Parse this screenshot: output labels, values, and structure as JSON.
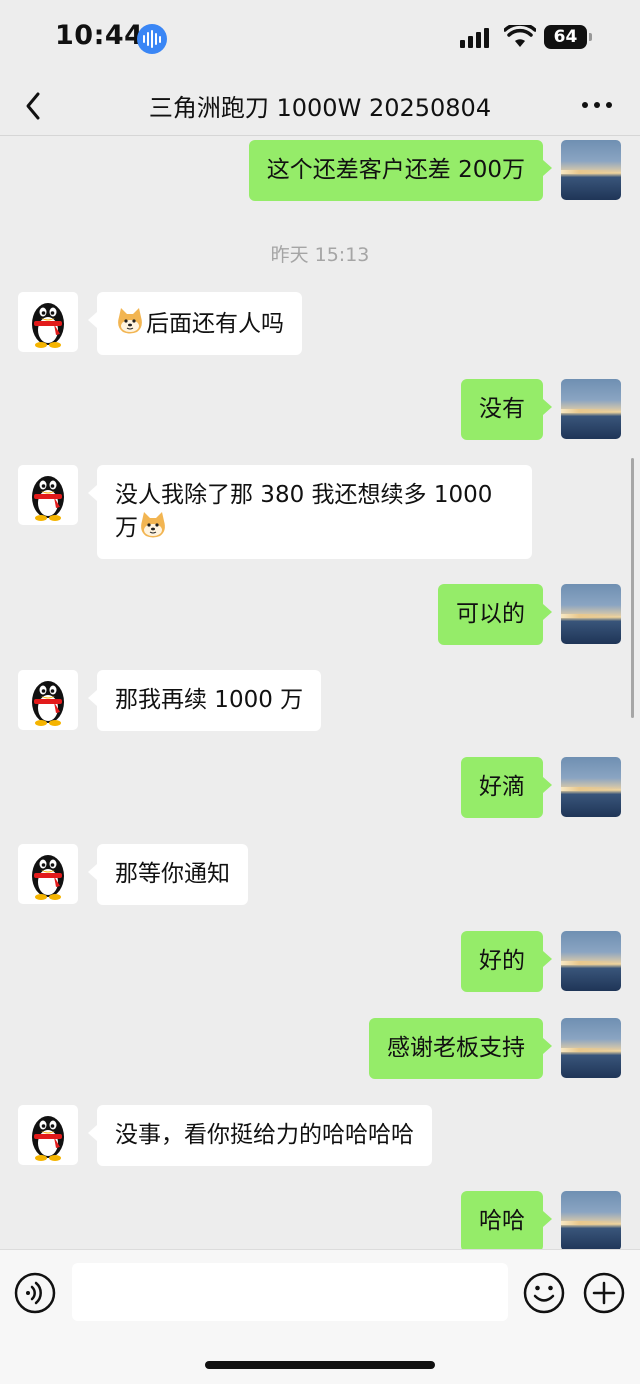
{
  "status_bar": {
    "time": "10:44",
    "battery": "64"
  },
  "header": {
    "title": "三角洲跑刀 1000W 20250804"
  },
  "icons": {
    "back": "chevron-left-icon",
    "more": "more-dots-icon",
    "voice": "voice-icon",
    "emoji": "smiley-icon",
    "plus": "plus-icon",
    "contact_avatar": "penguin-avatar-icon",
    "self_avatar": "sunset-avatar-image",
    "sticker": "shiba-dog-emoji-icon"
  },
  "colors": {
    "background": "#ededed",
    "outgoing_bubble": "#95ec69",
    "incoming_bubble": "#ffffff",
    "timestamp": "#a5a5a5"
  },
  "messages": [
    {
      "from": "me",
      "text": "这个还差客户还差 200万"
    },
    {
      "type": "timestamp",
      "text": "昨天 15:13"
    },
    {
      "from": "contact",
      "emoji": "shiba-dog",
      "text": "后面还有人吗"
    },
    {
      "from": "me",
      "text": "没有"
    },
    {
      "from": "contact",
      "line1": "没人我除了那 380 我还想续多 1000",
      "line2": "万",
      "emoji": "shiba-dog"
    },
    {
      "from": "me",
      "text": "可以的"
    },
    {
      "from": "contact",
      "text": "那我再续 1000 万"
    },
    {
      "from": "me",
      "text": "好滴"
    },
    {
      "from": "contact",
      "text": "那等你通知"
    },
    {
      "from": "me",
      "text": "好的"
    },
    {
      "from": "me",
      "text": "感谢老板支持"
    },
    {
      "from": "contact",
      "text": "没事，看你挺给力的哈哈哈哈"
    },
    {
      "from": "me",
      "text": "哈哈"
    }
  ],
  "input": {
    "value": "",
    "placeholder": ""
  }
}
